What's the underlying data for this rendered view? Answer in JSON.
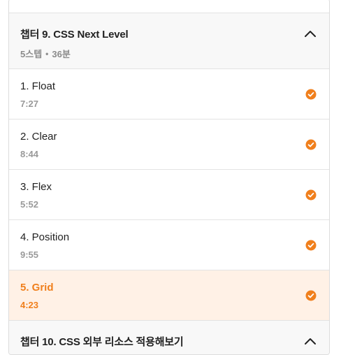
{
  "chapter9": {
    "title": "챕터 9. CSS Next Level",
    "steps": "5스텝",
    "separator": "•",
    "duration": "36분"
  },
  "lessons": [
    {
      "title": "1. Float",
      "time": "7:27"
    },
    {
      "title": "2. Clear",
      "time": "8:44"
    },
    {
      "title": "3. Flex",
      "time": "5:52"
    },
    {
      "title": "4. Position",
      "time": "9:55"
    },
    {
      "title": "5. Grid",
      "time": "4:23"
    }
  ],
  "chapter10": {
    "title": "챕터 10. CSS 외부 리소스 적용해보기"
  },
  "colors": {
    "accent": "#f07f1c",
    "active_bg": "#fff1e6",
    "header_bg": "#f8f8f8"
  },
  "icons": {
    "chevron": "chevron-up-icon",
    "check": "check-circle-icon"
  }
}
